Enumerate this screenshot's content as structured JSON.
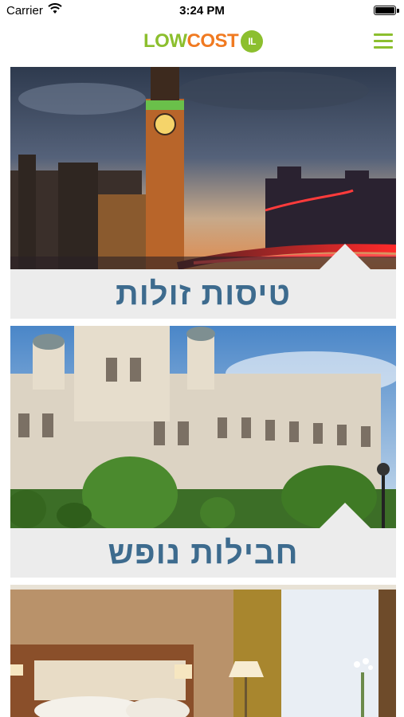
{
  "status_bar": {
    "carrier": "Carrier",
    "time": "3:24 PM",
    "wifi_icon": "wifi-icon",
    "battery_icon": "battery-icon"
  },
  "header": {
    "logo_part1": "LOW",
    "logo_part2": "COST",
    "logo_badge": "IL",
    "menu_icon": "hamburger-menu-icon",
    "colors": {
      "green": "#8cbf2e",
      "orange": "#f07a21"
    }
  },
  "cards": [
    {
      "label": "טיסות זולות",
      "image": "london-big-ben-photo"
    },
    {
      "label": "חבילות נופש",
      "image": "vienna-palace-photo"
    },
    {
      "label": "",
      "image": "hotel-room-photo"
    }
  ],
  "colors": {
    "label_text": "#3d6b8e",
    "label_bg": "#ececec"
  }
}
